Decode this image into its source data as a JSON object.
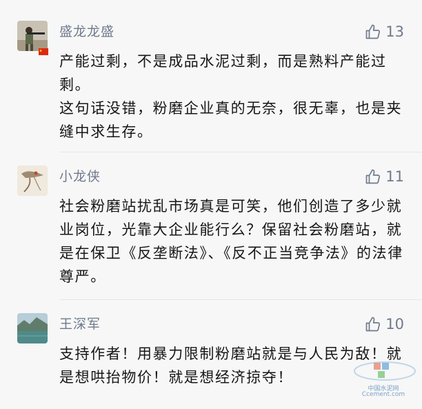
{
  "comments": [
    {
      "name": "盛龙龙盛",
      "likes": "13",
      "paragraphs": [
        "产能过剩，不是成品水泥过剩，而是熟料产能过剩。",
        "这句话没错，粉磨企业真的无奈，很无辜，也是夹缝中求生存。"
      ]
    },
    {
      "name": "小龙侠",
      "likes": "11",
      "paragraphs": [
        "社会粉磨站扰乱市场真是可笑，他们创造了多少就业岗位，光靠大企业能行么？保留社会粉磨站，就是在保卫《反垄断法》、《反不正当竞争法》的法律尊严。"
      ]
    },
    {
      "name": "王深军",
      "likes": "10",
      "paragraphs": [
        "支持作者！用暴力限制粉磨站就是与人民为敌！就是想哄抬物价！就是想经济掠夺！"
      ]
    }
  ],
  "watermark": {
    "line1": "中国水泥网",
    "line2": "Ccement.com"
  },
  "icons": {
    "like": "thumbs-up-icon",
    "flag": "china-flag-icon"
  },
  "colors": {
    "name": "#6f7a8c",
    "text": "#161616",
    "background": "#f7f7f7"
  }
}
